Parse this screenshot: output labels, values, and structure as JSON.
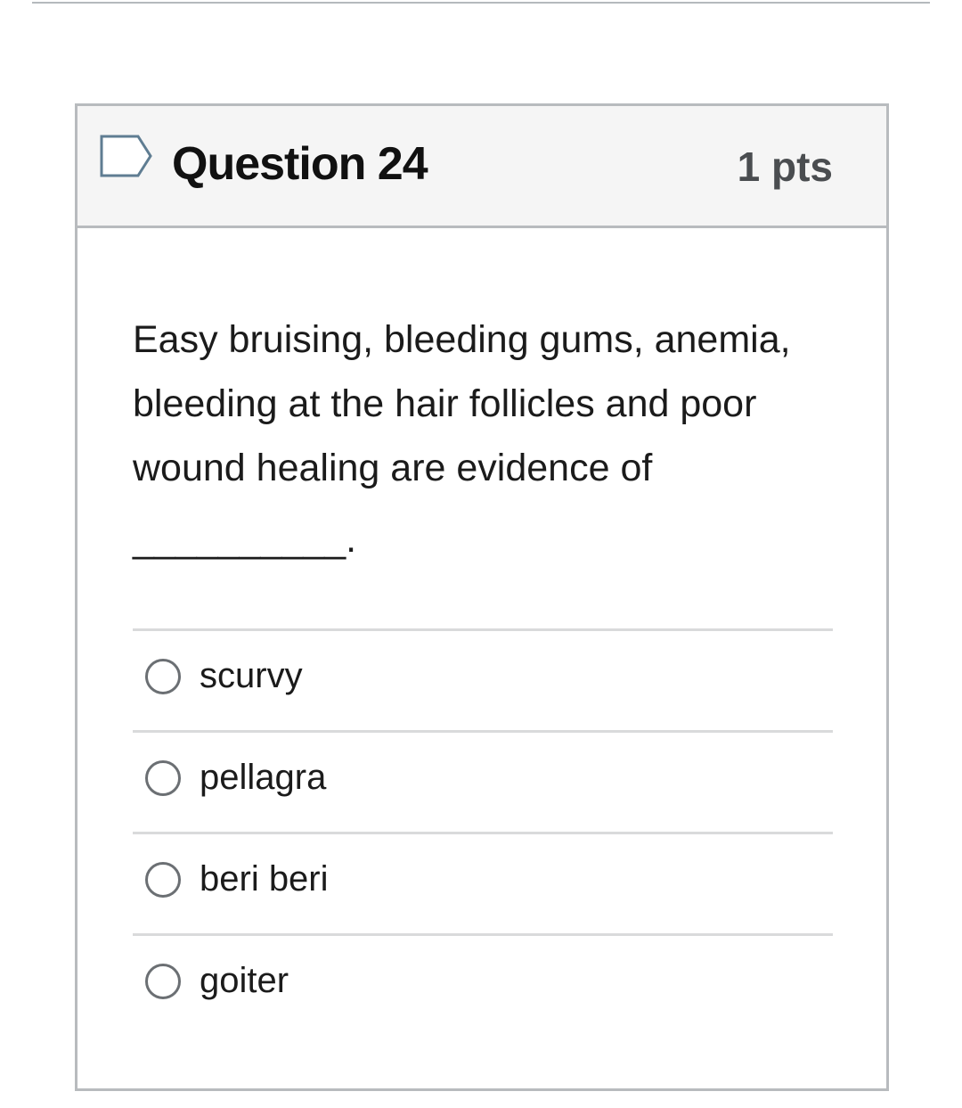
{
  "question": {
    "title": "Question 24",
    "points": "1 pts",
    "text_lines": [
      "Easy bruising, bleeding gums, anemia,",
      "bleeding at the hair follicles and poor",
      "wound healing are evidence of",
      "__________."
    ]
  },
  "answers": [
    {
      "label": "scurvy"
    },
    {
      "label": "pellagra"
    },
    {
      "label": "beri beri"
    },
    {
      "label": "goiter"
    }
  ],
  "icons": {
    "flag": "flag-icon",
    "radio": "radio-button-icon"
  },
  "colors": {
    "header_bg": "#f5f5f5",
    "border": "#b8bbbe",
    "flag_outline": "#5f7d92",
    "text": "#1b1b1b"
  }
}
